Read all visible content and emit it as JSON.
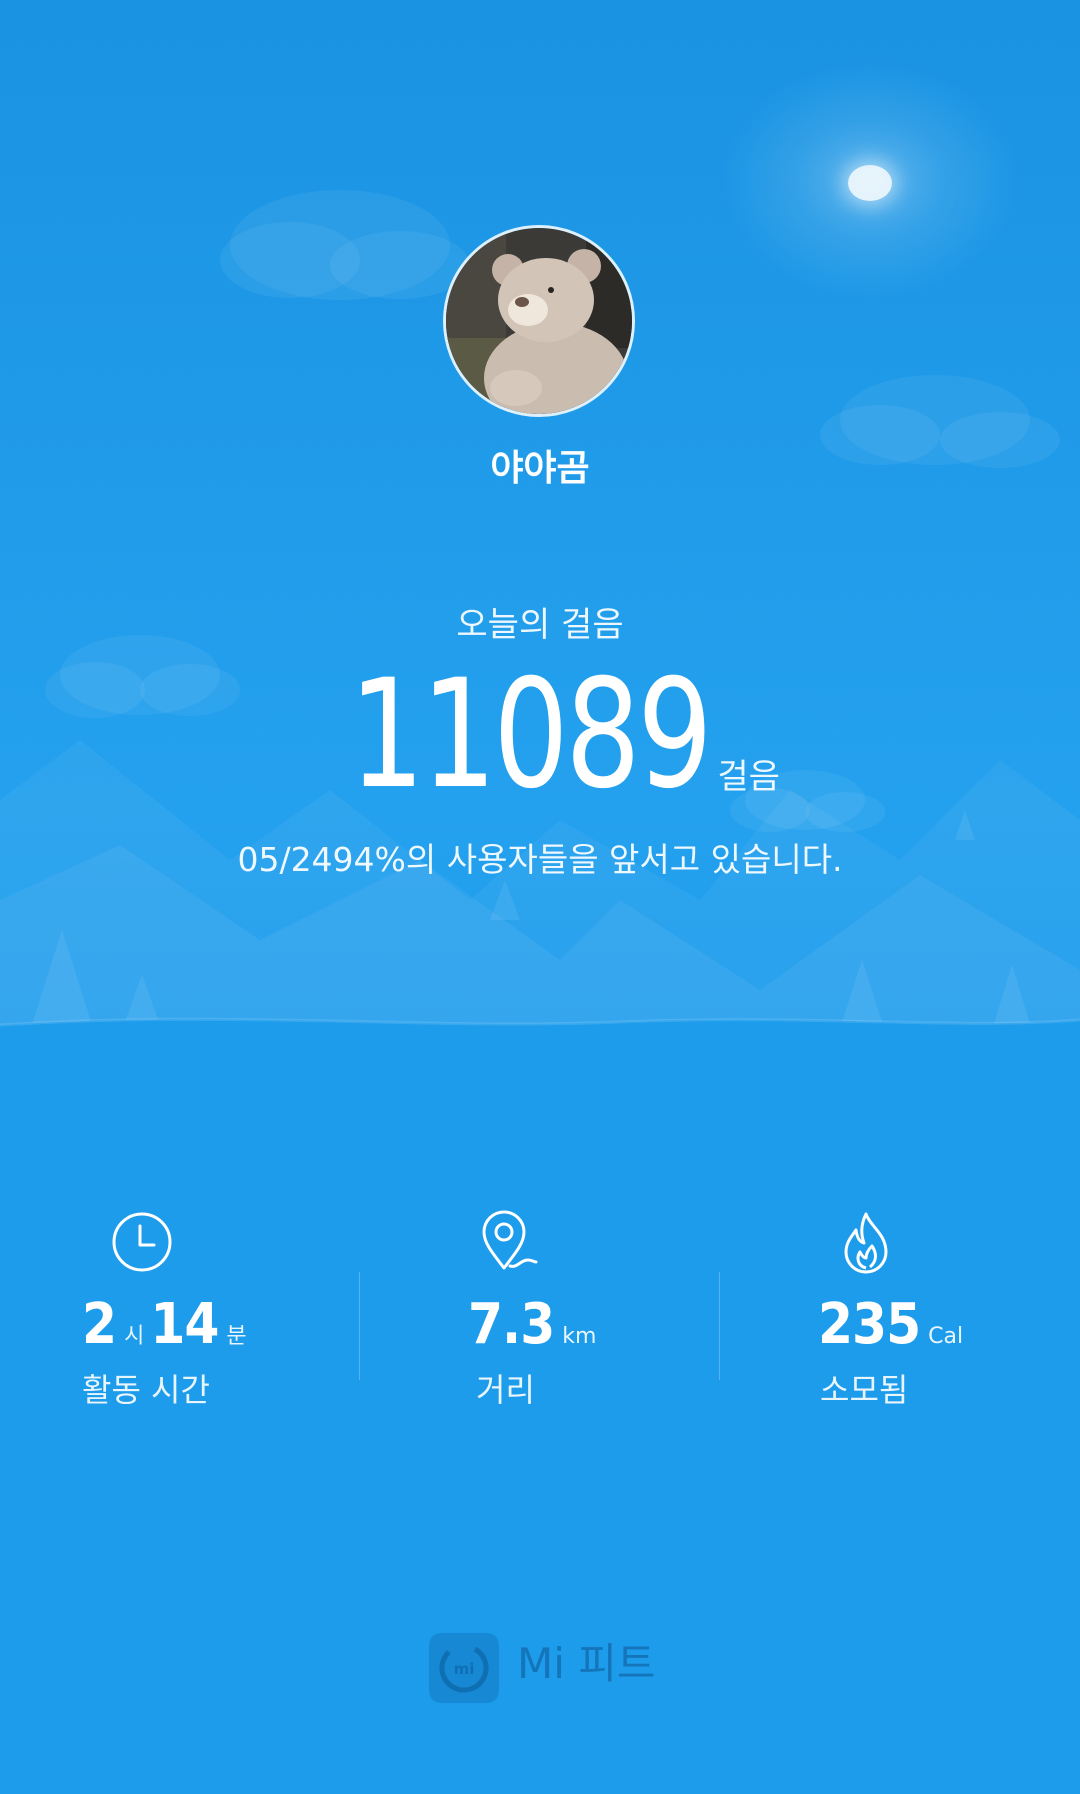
{
  "profile": {
    "name": "야야곰"
  },
  "steps": {
    "label": "오늘의 걸음",
    "value": "11089",
    "unit": "걸음",
    "rank_text": "05/2494%의 사용자들을 앞서고 있습니다."
  },
  "stats": {
    "active_time": {
      "hours": "2",
      "hours_unit": "시",
      "minutes": "14",
      "minutes_unit": "분",
      "label": "활동 시간",
      "icon": "clock-icon"
    },
    "distance": {
      "value": "7.3",
      "unit": "km",
      "label": "거리",
      "icon": "location-pin-icon"
    },
    "calories": {
      "value": "235",
      "unit": "Cal",
      "label": "소모됨",
      "icon": "flame-icon"
    }
  },
  "footer": {
    "app_name": "Mi 피트",
    "logo_text": "mi"
  },
  "colors": {
    "background": "#1d9cec",
    "footer_text": "#1575bb",
    "logo_bg": "#1688d4"
  }
}
